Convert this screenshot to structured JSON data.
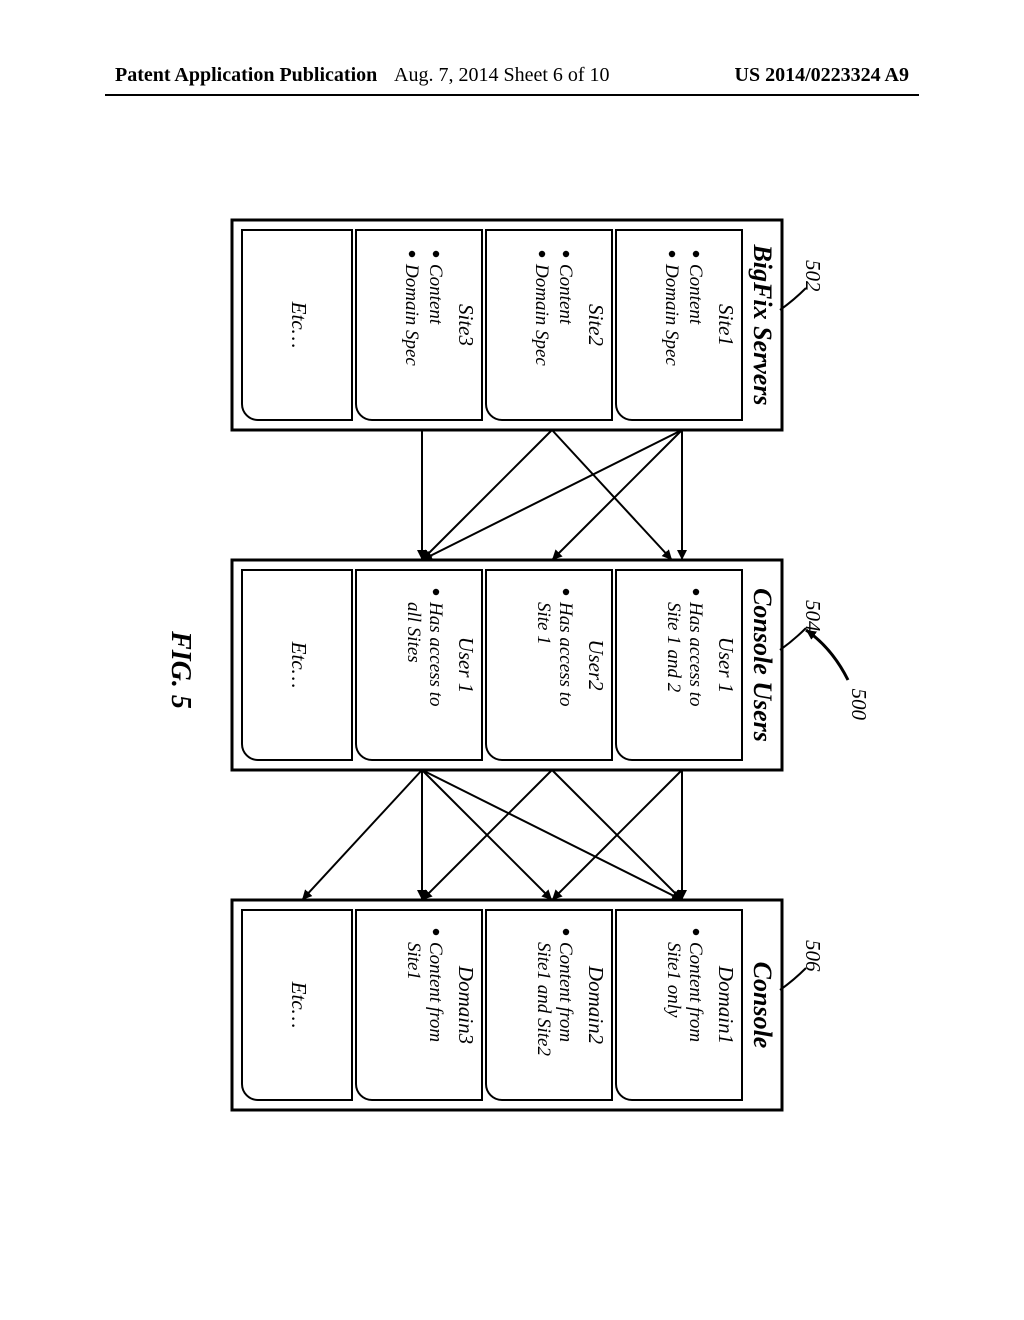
{
  "header": {
    "left": "Patent Application Publication",
    "center": "Aug. 7, 2014  Sheet 6 of 10",
    "right": "US 2014/0223324 A9"
  },
  "figure": {
    "id_label": "500",
    "caption": "FIG. 5",
    "columns": [
      {
        "ref": "502",
        "title": "BigFix Servers",
        "cards": [
          {
            "title": "Site1",
            "lines": [
              "Content",
              "Domain Spec"
            ]
          },
          {
            "title": "Site2",
            "lines": [
              "Content",
              "Domain Spec"
            ]
          },
          {
            "title": "Site3",
            "lines": [
              "Content",
              "Domain Spec"
            ]
          },
          {
            "title": "Etc…",
            "lines": []
          }
        ]
      },
      {
        "ref": "504",
        "title": "Console Users",
        "cards": [
          {
            "title": "User 1",
            "lines": [
              "Has access to",
              "Site 1 and 2"
            ]
          },
          {
            "title": "User2",
            "lines": [
              "Has access to",
              "Site 1"
            ]
          },
          {
            "title": "User 1",
            "lines": [
              "Has access to",
              "all Sites"
            ]
          },
          {
            "title": "Etc…",
            "lines": []
          }
        ]
      },
      {
        "ref": "506",
        "title": "Console",
        "cards": [
          {
            "title": "Domain1",
            "lines": [
              "Content from",
              "Site1 only"
            ]
          },
          {
            "title": "Domain2",
            "lines": [
              "Content from",
              "Site1 and Site2"
            ]
          },
          {
            "title": "Domain3",
            "lines": [
              "Content from",
              "Site1"
            ]
          },
          {
            "title": "Etc…",
            "lines": []
          }
        ]
      }
    ]
  }
}
